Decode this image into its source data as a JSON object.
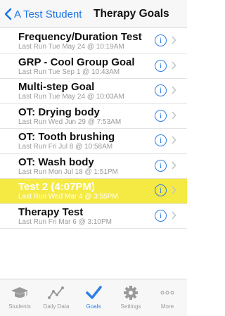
{
  "nav": {
    "back_label": "A Test Student",
    "title": "Therapy Goals"
  },
  "goals": [
    {
      "name": "Frequency/Duration Test",
      "last_run": "Last Run Tue May 24 @ 10:19AM",
      "highlighted": false
    },
    {
      "name": "GRP - Cool Group Goal",
      "last_run": "Last Run Tue Sep 1 @ 10:43AM",
      "highlighted": false
    },
    {
      "name": "Multi-step Goal",
      "last_run": "Last Run Tue May 24 @ 10:03AM",
      "highlighted": false
    },
    {
      "name": "OT: Drying body",
      "last_run": "Last Run Wed Jun 29 @ 7:53AM",
      "highlighted": false
    },
    {
      "name": "OT: Tooth brushing",
      "last_run": "Last Run Fri Jul 8 @ 10:58AM",
      "highlighted": false
    },
    {
      "name": "OT: Wash body",
      "last_run": "Last Run Mon Jul 18 @ 1:51PM",
      "highlighted": false
    },
    {
      "name": "Test 2 (4:07PM)",
      "last_run": "Last Run Wed Mar 4 @ 3:55PM",
      "highlighted": true
    },
    {
      "name": "Therapy Test",
      "last_run": "Last Run Fri Mar 6 @ 3:10PM",
      "highlighted": false
    }
  ],
  "row_icons": {
    "info": "info-icon",
    "chevron": "chevron-right-icon"
  },
  "tabs": [
    {
      "label": "Students",
      "icon": "graduation-cap-icon",
      "active": false
    },
    {
      "label": "Daily Data",
      "icon": "line-graph-icon",
      "active": false
    },
    {
      "label": "Goals",
      "icon": "checkmark-icon",
      "active": true
    },
    {
      "label": "Settings",
      "icon": "gear-icon",
      "active": false
    },
    {
      "label": "More",
      "icon": "more-dots-icon",
      "active": false
    }
  ],
  "colors": {
    "accent": "#2f7ee8",
    "highlight_row": "#f5ea43",
    "inactive": "#9a9a9a"
  }
}
